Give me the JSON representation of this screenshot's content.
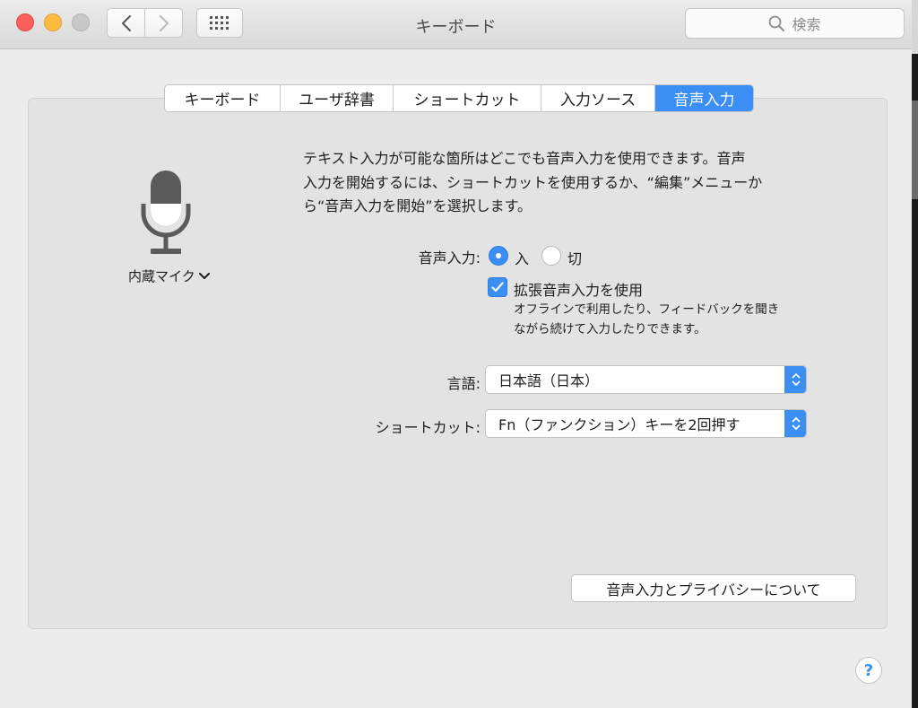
{
  "window": {
    "title": "キーボード",
    "search_placeholder": "検索"
  },
  "tabs": [
    {
      "label": "キーボード",
      "active": false
    },
    {
      "label": "ユーザ辞書",
      "active": false
    },
    {
      "label": "ショートカット",
      "active": false
    },
    {
      "label": "入力ソース",
      "active": false
    },
    {
      "label": "音声入力",
      "active": true
    }
  ],
  "microphone": {
    "label": "内蔵マイク",
    "icon": "microphone-icon"
  },
  "description": {
    "line1": "テキスト入力が可能な箇所はどこでも音声入力を使用できます。音声",
    "line2": "入力を開始するには、ショートカットを使用するか、“編集”メニューか",
    "line3": "ら“音声入力を開始”を選択します。"
  },
  "dictation": {
    "label": "音声入力:",
    "on_label": "入",
    "off_label": "切",
    "selected": "on"
  },
  "enhanced": {
    "label": "拡張音声入力を使用",
    "checked": true,
    "desc_line1": "オフラインで利用したり、フィードバックを聞き",
    "desc_line2": "ながら続けて入力したりできます。"
  },
  "language": {
    "label": "言語:",
    "value": "日本語（日本）"
  },
  "shortcut": {
    "label": "ショートカット:",
    "value": "Fn（ファンクション）キーを2回押す"
  },
  "privacy_button": "音声入力とプライバシーについて",
  "help": "?",
  "colors": {
    "accent": "#3b8ef3",
    "close": "#fc605c",
    "minimize": "#fdbc40",
    "zoom_disabled": "#c8c8c8"
  }
}
